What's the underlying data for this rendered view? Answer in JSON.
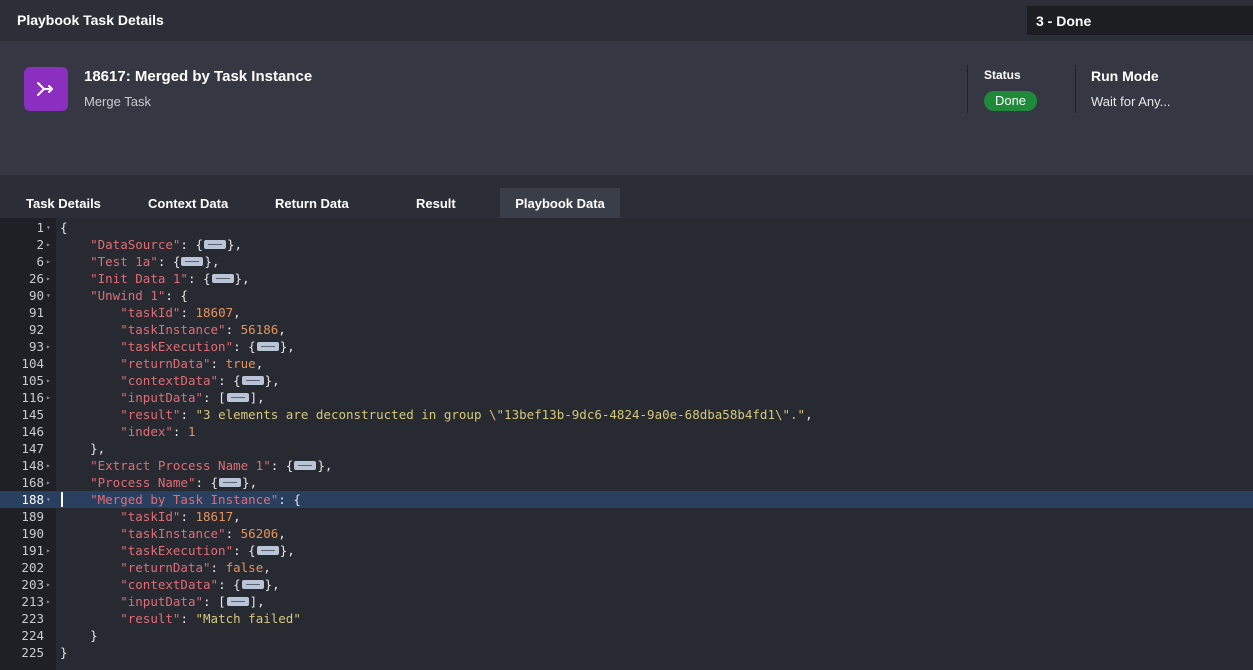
{
  "window": {
    "title": "Playbook Task Details",
    "status_pill": "3 - Done"
  },
  "task": {
    "icon": "merge-icon",
    "title": "18617: Merged by Task Instance",
    "subtitle": "Merge Task",
    "status_label": "Status",
    "status_value": "Done",
    "run_mode_label": "Run Mode",
    "run_mode_value": "Wait for Any..."
  },
  "colors": {
    "accent_purple": "#8a2fbf",
    "status_green": "#1f8b3a",
    "highlight": "#283f60"
  },
  "tabs": [
    {
      "label": "Task Details",
      "active": false
    },
    {
      "label": "Context Data",
      "active": false
    },
    {
      "label": "Return Data",
      "active": false
    },
    {
      "label": "Result",
      "active": false
    },
    {
      "label": "Playbook Data",
      "active": true
    }
  ],
  "editor": {
    "lines": [
      {
        "num": "1",
        "indent": 0,
        "fold": "open",
        "tokens": [
          [
            "p",
            "{"
          ]
        ]
      },
      {
        "num": "2",
        "indent": 1,
        "fold": "closed",
        "tokens": [
          [
            "k",
            "\"DataSource\""
          ],
          [
            "p",
            ": {"
          ],
          [
            "c",
            ""
          ],
          [
            "p",
            "},"
          ]
        ]
      },
      {
        "num": "6",
        "indent": 1,
        "fold": "closed",
        "tokens": [
          [
            "k",
            "\"Test 1a\""
          ],
          [
            "p",
            ": {"
          ],
          [
            "c",
            ""
          ],
          [
            "p",
            "},"
          ]
        ]
      },
      {
        "num": "26",
        "indent": 1,
        "fold": "closed",
        "tokens": [
          [
            "k",
            "\"Init Data 1\""
          ],
          [
            "p",
            ": {"
          ],
          [
            "c",
            ""
          ],
          [
            "p",
            "},"
          ]
        ]
      },
      {
        "num": "90",
        "indent": 1,
        "fold": "open",
        "tokens": [
          [
            "k",
            "\"Unwind 1\""
          ],
          [
            "p",
            ": {"
          ]
        ]
      },
      {
        "num": "91",
        "indent": 2,
        "fold": "",
        "tokens": [
          [
            "k",
            "\"taskId\""
          ],
          [
            "p",
            ": "
          ],
          [
            "n",
            "18607"
          ],
          [
            "p",
            ","
          ]
        ]
      },
      {
        "num": "92",
        "indent": 2,
        "fold": "",
        "tokens": [
          [
            "k",
            "\"taskInstance\""
          ],
          [
            "p",
            ": "
          ],
          [
            "n",
            "56186"
          ],
          [
            "p",
            ","
          ]
        ]
      },
      {
        "num": "93",
        "indent": 2,
        "fold": "closed",
        "tokens": [
          [
            "k",
            "\"taskExecution\""
          ],
          [
            "p",
            ": {"
          ],
          [
            "c",
            ""
          ],
          [
            "p",
            "},"
          ]
        ]
      },
      {
        "num": "104",
        "indent": 2,
        "fold": "",
        "tokens": [
          [
            "k",
            "\"returnData\""
          ],
          [
            "p",
            ": "
          ],
          [
            "n",
            "true"
          ],
          [
            "p",
            ","
          ]
        ]
      },
      {
        "num": "105",
        "indent": 2,
        "fold": "closed",
        "tokens": [
          [
            "k",
            "\"contextData\""
          ],
          [
            "p",
            ": {"
          ],
          [
            "c",
            ""
          ],
          [
            "p",
            "},"
          ]
        ]
      },
      {
        "num": "116",
        "indent": 2,
        "fold": "closed",
        "tokens": [
          [
            "k",
            "\"inputData\""
          ],
          [
            "p",
            ": ["
          ],
          [
            "c",
            ""
          ],
          [
            "p",
            "],"
          ]
        ]
      },
      {
        "num": "145",
        "indent": 2,
        "fold": "",
        "tokens": [
          [
            "k",
            "\"result\""
          ],
          [
            "p",
            ": "
          ],
          [
            "s",
            "\"3 elements are deconstructed in group \\\"13bef13b-9dc6-4824-9a0e-68dba58b4fd1\\\".\""
          ],
          [
            "p",
            ","
          ]
        ]
      },
      {
        "num": "146",
        "indent": 2,
        "fold": "",
        "tokens": [
          [
            "k",
            "\"index\""
          ],
          [
            "p",
            ": "
          ],
          [
            "n",
            "1"
          ]
        ]
      },
      {
        "num": "147",
        "indent": 1,
        "fold": "",
        "tokens": [
          [
            "p",
            "},"
          ]
        ]
      },
      {
        "num": "148",
        "indent": 1,
        "fold": "closed",
        "tokens": [
          [
            "k",
            "\"Extract Process Name 1\""
          ],
          [
            "p",
            ": {"
          ],
          [
            "c",
            ""
          ],
          [
            "p",
            "},"
          ]
        ]
      },
      {
        "num": "168",
        "indent": 1,
        "fold": "closed",
        "tokens": [
          [
            "k",
            "\"Process Name\""
          ],
          [
            "p",
            ": {"
          ],
          [
            "c",
            ""
          ],
          [
            "p",
            "},"
          ]
        ]
      },
      {
        "num": "188",
        "indent": 1,
        "fold": "open",
        "highlight": true,
        "tokens": [
          [
            "k",
            "\"Merged by Task Instance\""
          ],
          [
            "p",
            ": {"
          ]
        ]
      },
      {
        "num": "189",
        "indent": 2,
        "fold": "",
        "tokens": [
          [
            "k",
            "\"taskId\""
          ],
          [
            "p",
            ": "
          ],
          [
            "n",
            "18617"
          ],
          [
            "p",
            ","
          ]
        ]
      },
      {
        "num": "190",
        "indent": 2,
        "fold": "",
        "tokens": [
          [
            "k",
            "\"taskInstance\""
          ],
          [
            "p",
            ": "
          ],
          [
            "n",
            "56206"
          ],
          [
            "p",
            ","
          ]
        ]
      },
      {
        "num": "191",
        "indent": 2,
        "fold": "closed",
        "tokens": [
          [
            "k",
            "\"taskExecution\""
          ],
          [
            "p",
            ": {"
          ],
          [
            "c",
            ""
          ],
          [
            "p",
            "},"
          ]
        ]
      },
      {
        "num": "202",
        "indent": 2,
        "fold": "",
        "tokens": [
          [
            "k",
            "\"returnData\""
          ],
          [
            "p",
            ": "
          ],
          [
            "n",
            "false"
          ],
          [
            "p",
            ","
          ]
        ]
      },
      {
        "num": "203",
        "indent": 2,
        "fold": "closed",
        "tokens": [
          [
            "k",
            "\"contextData\""
          ],
          [
            "p",
            ": {"
          ],
          [
            "c",
            ""
          ],
          [
            "p",
            "},"
          ]
        ]
      },
      {
        "num": "213",
        "indent": 2,
        "fold": "closed",
        "tokens": [
          [
            "k",
            "\"inputData\""
          ],
          [
            "p",
            ": ["
          ],
          [
            "c",
            ""
          ],
          [
            "p",
            "],"
          ]
        ]
      },
      {
        "num": "223",
        "indent": 2,
        "fold": "",
        "tokens": [
          [
            "k",
            "\"result\""
          ],
          [
            "p",
            ": "
          ],
          [
            "s",
            "\"Match failed\""
          ]
        ]
      },
      {
        "num": "224",
        "indent": 1,
        "fold": "",
        "tokens": [
          [
            "p",
            "}"
          ]
        ]
      },
      {
        "num": "225",
        "indent": 0,
        "fold": "",
        "tokens": [
          [
            "p",
            "}"
          ]
        ]
      }
    ]
  }
}
